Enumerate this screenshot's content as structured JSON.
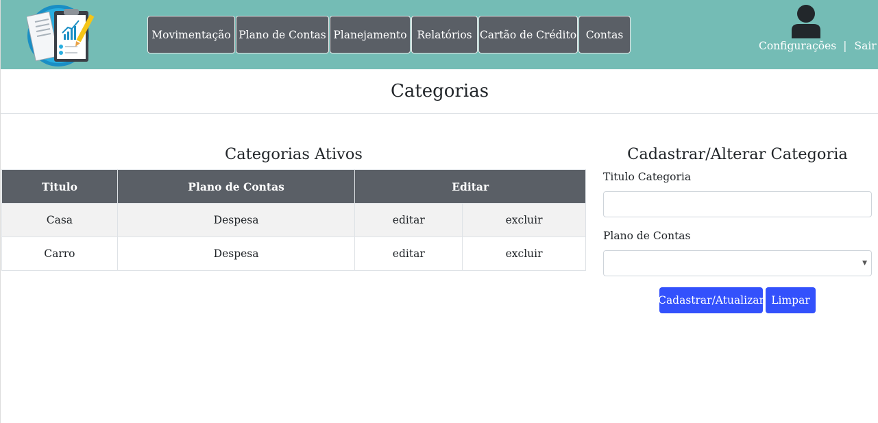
{
  "nav": {
    "items": [
      {
        "label": "Movimentação"
      },
      {
        "label": "Plano de Contas"
      },
      {
        "label": "Planejamento"
      },
      {
        "label": "Relatórios"
      },
      {
        "label": "Cartão de Crédito"
      },
      {
        "label": "Contas"
      }
    ]
  },
  "user": {
    "settings_label": "Configurações",
    "separator": "|",
    "logout_label": "Sair"
  },
  "page": {
    "title": "Categorias"
  },
  "list": {
    "title": "Categorias Ativos",
    "columns": [
      "Titulo",
      "Plano de Contas",
      "Editar"
    ],
    "rows": [
      {
        "titulo": "Casa",
        "plano": "Despesa",
        "edit": "editar",
        "delete": "excluir"
      },
      {
        "titulo": "Carro",
        "plano": "Despesa",
        "edit": "editar",
        "delete": "excluir"
      }
    ]
  },
  "form": {
    "title": "Cadastrar/Alterar Categoria",
    "titulo_label": "Titulo Categoria",
    "titulo_value": "",
    "plano_label": "Plano de Contas",
    "plano_value": "",
    "submit_label": "Cadastrar/Atualizar",
    "clear_label": "Limpar"
  },
  "colors": {
    "header": "#74bcb5",
    "nav_button": "#5a5f66",
    "table_header": "#5a5f66",
    "primary_button": "#3351fc"
  }
}
